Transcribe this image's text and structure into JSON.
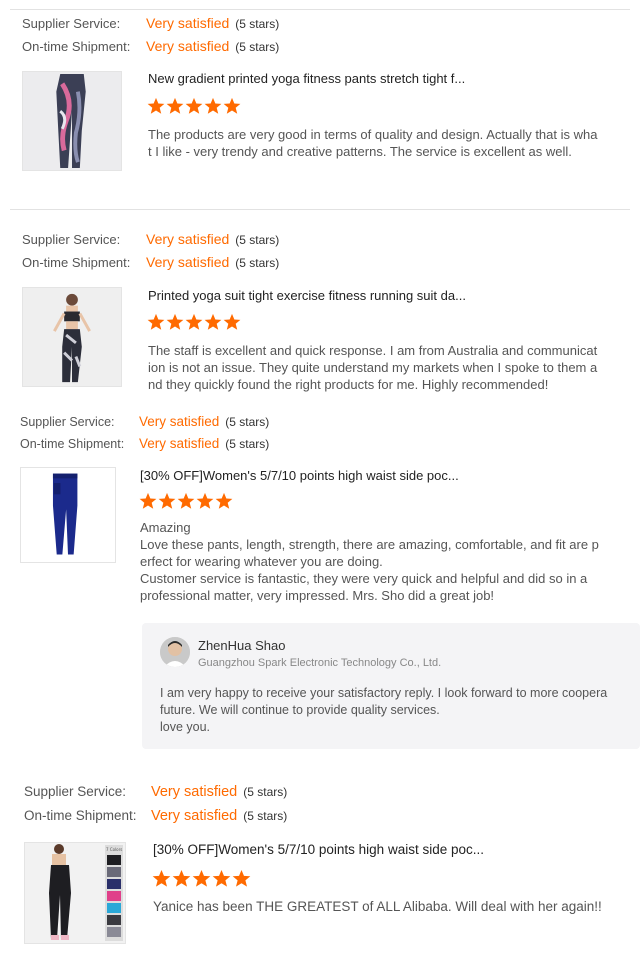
{
  "colors": {
    "accent": "#ff6a00",
    "divider": "#e2e2e2",
    "reply_bg": "#f4f4f6"
  },
  "icons": {
    "star": "star-icon",
    "avatar": "avatar"
  },
  "reviews": [
    {
      "supplier_label": "Supplier Service:",
      "supplier_value": "Very satisfied",
      "supplier_note": "(5 stars)",
      "shipment_label": "On-time Shipment:",
      "shipment_value": "Very satisfied",
      "shipment_note": "(5 stars)",
      "product_title": "New gradient printed yoga fitness pants stretch tight f...",
      "rating": 5,
      "body_lines": [
        "The products are very good in terms of quality and design. Actually that is wha",
        "t I like - very trendy and creative patterns. The service is excellent as well."
      ]
    },
    {
      "supplier_label": "Supplier Service:",
      "supplier_value": "Very satisfied",
      "supplier_note": "(5 stars)",
      "shipment_label": "On-time Shipment:",
      "shipment_value": "Very satisfied",
      "shipment_note": "(5 stars)",
      "product_title": "Printed yoga suit tight exercise fitness running suit da...",
      "rating": 5,
      "body_lines": [
        "The staff is excellent and quick response. I am from Australia and communicat",
        "ion is not an issue. They quite understand my markets when I spoke to them a",
        "nd they quickly found the right products for me. Highly recommended!"
      ]
    },
    {
      "supplier_label": "Supplier Service:",
      "supplier_value": "Very satisfied",
      "supplier_note": "(5 stars)",
      "shipment_label": "On-time Shipment:",
      "shipment_value": "Very satisfied",
      "shipment_note": "(5 stars)",
      "product_title": "[30% OFF]Women's 5/7/10 points high waist side poc...",
      "rating": 5,
      "body_lines": [
        "Amazing",
        "Love these pants, length, strength, there are amazing, comfortable, and fit are p",
        "erfect for wearing whatever you are doing.",
        "Customer service is fantastic, they were very quick and helpful and did so in a",
        "professional matter, very impressed. Mrs. Sho did a great job!"
      ],
      "reply": {
        "name": "ZhenHua Shao",
        "company": "Guangzhou Spark Electronic Technology Co., Ltd.",
        "lines": [
          "I am very happy to receive your satisfactory reply. I look forward to more coopera",
          "future. We will continue to provide quality services.",
          "love you."
        ]
      }
    },
    {
      "supplier_label": "Supplier Service:",
      "supplier_value": "Very satisfied",
      "supplier_note": "(5 stars)",
      "shipment_label": "On-time Shipment:",
      "shipment_value": "Very satisfied",
      "shipment_note": "(5 stars)",
      "product_title": "[30% OFF]Women's 5/7/10 points high waist side poc...",
      "thumb_badge": "7 Colors",
      "rating": 5,
      "body_lines": [
        "Yanice has been THE GREATEST of ALL Alibaba. Will deal with her again!!"
      ]
    }
  ]
}
